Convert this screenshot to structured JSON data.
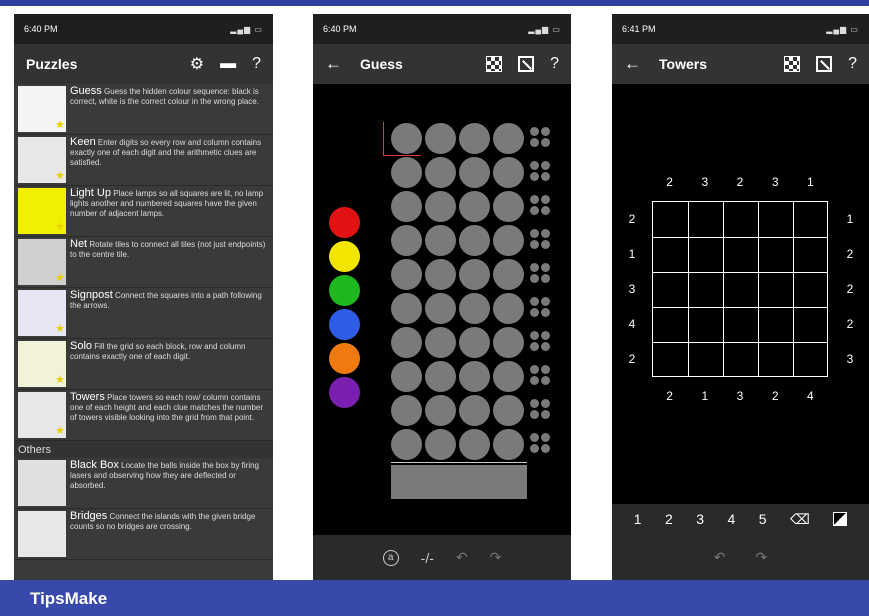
{
  "brand": "TipsMake",
  "phone1": {
    "time": "6:40 PM",
    "title": "Puzzles",
    "icons": [
      "gear-icon",
      "folder-icon",
      "help-icon"
    ],
    "help": "?",
    "puzzles": [
      {
        "name": "Guess",
        "desc": "Guess the hidden colour sequence: black is correct, white is the correct colour in the wrong place."
      },
      {
        "name": "Keen",
        "desc": "Enter digits so every row and column contains exactly one of each digit and the arithmetic clues are satisfied."
      },
      {
        "name": "Light Up",
        "desc": "Place lamps so all squares are lit, no lamp lights another and numbered squares have the given number of adjacent lamps."
      },
      {
        "name": "Net",
        "desc": "Rotate tiles to connect all tiles (not just endpoints) to the centre tile."
      },
      {
        "name": "Signpost",
        "desc": "Connect the squares into a path following the arrows."
      },
      {
        "name": "Solo",
        "desc": "Fill the grid so each block, row and column contains exactly one of each digit."
      },
      {
        "name": "Towers",
        "desc": "Place towers so each row/ column contains one of each height and each clue matches the number of towers visible looking into the grid from that point."
      }
    ],
    "others_label": "Others",
    "others": [
      {
        "name": "Black Box",
        "desc": "Locate the balls inside the box by firing lasers and observing how they are deflected or absorbed."
      },
      {
        "name": "Bridges",
        "desc": "Connect the islands with the given bridge counts so no bridges are crossing."
      }
    ]
  },
  "phone2": {
    "time": "6:40 PM",
    "title": "Guess",
    "back": "←",
    "help": "?",
    "palette": [
      "#e31212",
      "#f2e600",
      "#1fb81f",
      "#2e5ce6",
      "#f07a10",
      "#7a1fb0"
    ],
    "peg_color": "#7a7a7a",
    "rows": 10,
    "pegs_per_row": 4,
    "controls": [
      "a",
      "-/-",
      "undo",
      "redo"
    ]
  },
  "phone3": {
    "time": "6:41 PM",
    "title": "Towers",
    "back": "←",
    "help": "?",
    "top_clues": [
      "2",
      "3",
      "2",
      "3",
      "1"
    ],
    "bottom_clues": [
      "2",
      "1",
      "3",
      "2",
      "4"
    ],
    "left_clues": [
      "2",
      "1",
      "3",
      "4",
      "2"
    ],
    "right_clues": [
      "1",
      "2",
      "2",
      "2",
      "3"
    ],
    "digits": [
      "1",
      "2",
      "3",
      "4",
      "5"
    ]
  }
}
